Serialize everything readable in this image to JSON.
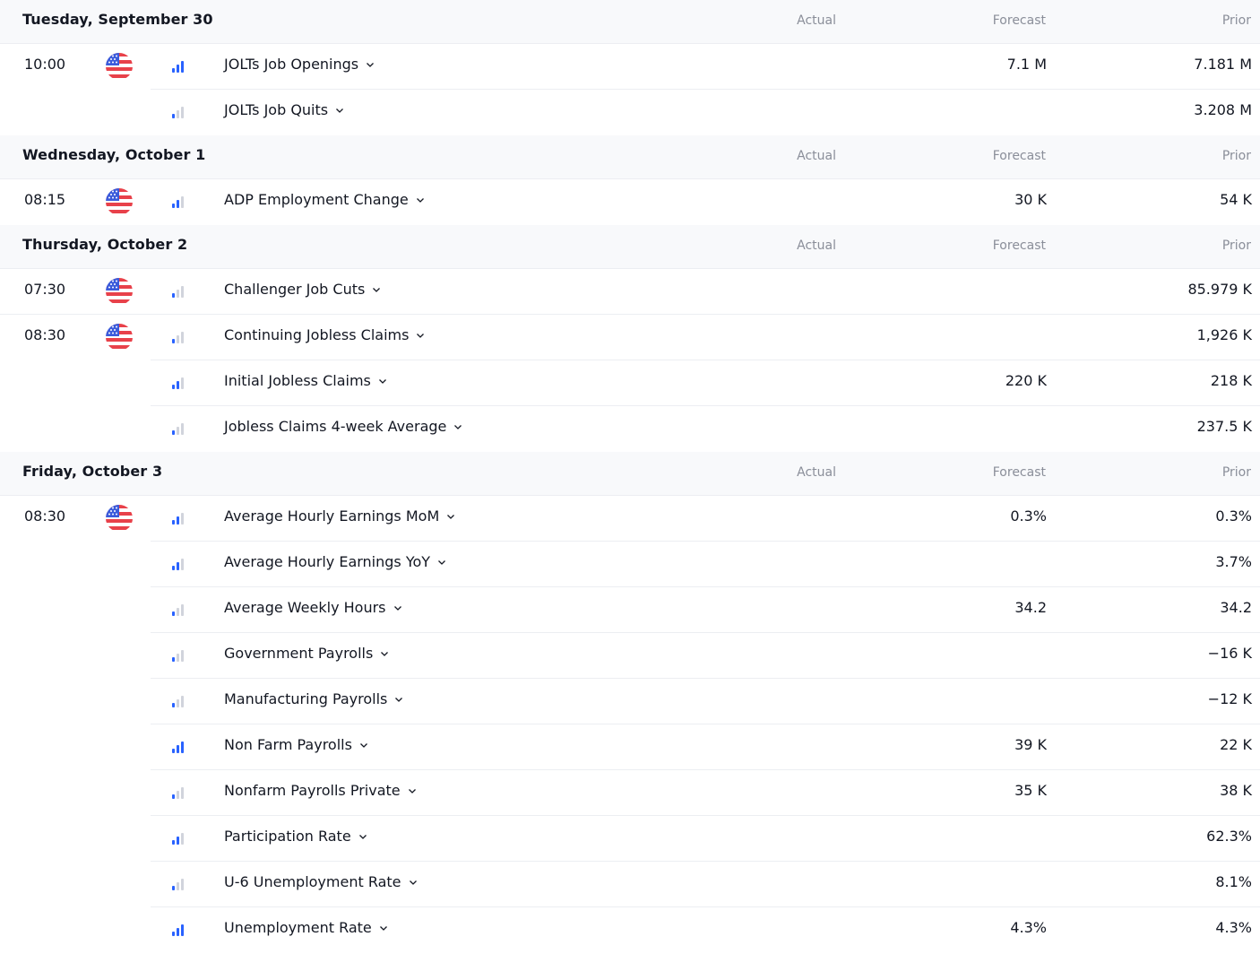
{
  "columns": {
    "actual": "Actual",
    "forecast": "Forecast",
    "prior": "Prior"
  },
  "colors": {
    "importance_on": "#2962ff",
    "importance_off": "#d1d4dc",
    "header_bg": "#f8f9fb"
  },
  "days": [
    {
      "title": "Tuesday, September 30",
      "events": [
        {
          "time": "10:00",
          "flag": true,
          "importance": 3,
          "name": "JOLTs Job Openings",
          "actual": "",
          "forecast": "7.1 M",
          "prior": "7.181 M"
        },
        {
          "time": "",
          "flag": false,
          "importance": 1,
          "name": "JOLTs Job Quits",
          "actual": "",
          "forecast": "",
          "prior": "3.208 M"
        }
      ]
    },
    {
      "title": "Wednesday, October 1",
      "events": [
        {
          "time": "08:15",
          "flag": true,
          "importance": 2,
          "name": "ADP Employment Change",
          "actual": "",
          "forecast": "30 K",
          "prior": "54 K"
        }
      ]
    },
    {
      "title": "Thursday, October 2",
      "events": [
        {
          "time": "07:30",
          "flag": true,
          "importance": 1,
          "name": "Challenger Job Cuts",
          "actual": "",
          "forecast": "",
          "prior": "85.979 K"
        },
        {
          "time": "08:30",
          "flag": true,
          "importance": 1,
          "name": "Continuing Jobless Claims",
          "actual": "",
          "forecast": "",
          "prior": "1,926 K"
        },
        {
          "time": "",
          "flag": false,
          "importance": 2,
          "name": "Initial Jobless Claims",
          "actual": "",
          "forecast": "220 K",
          "prior": "218 K"
        },
        {
          "time": "",
          "flag": false,
          "importance": 1,
          "name": "Jobless Claims 4-week Average",
          "actual": "",
          "forecast": "",
          "prior": "237.5 K"
        }
      ]
    },
    {
      "title": "Friday, October 3",
      "events": [
        {
          "time": "08:30",
          "flag": true,
          "importance": 2,
          "name": "Average Hourly Earnings MoM",
          "actual": "",
          "forecast": "0.3%",
          "prior": "0.3%"
        },
        {
          "time": "",
          "flag": false,
          "importance": 2,
          "name": "Average Hourly Earnings YoY",
          "actual": "",
          "forecast": "",
          "prior": "3.7%"
        },
        {
          "time": "",
          "flag": false,
          "importance": 1,
          "name": "Average Weekly Hours",
          "actual": "",
          "forecast": "34.2",
          "prior": "34.2"
        },
        {
          "time": "",
          "flag": false,
          "importance": 1,
          "name": "Government Payrolls",
          "actual": "",
          "forecast": "",
          "prior": "−16 K"
        },
        {
          "time": "",
          "flag": false,
          "importance": 1,
          "name": "Manufacturing Payrolls",
          "actual": "",
          "forecast": "",
          "prior": "−12 K"
        },
        {
          "time": "",
          "flag": false,
          "importance": 3,
          "name": "Non Farm Payrolls",
          "actual": "",
          "forecast": "39 K",
          "prior": "22 K"
        },
        {
          "time": "",
          "flag": false,
          "importance": 1,
          "name": "Nonfarm Payrolls Private",
          "actual": "",
          "forecast": "35 K",
          "prior": "38 K"
        },
        {
          "time": "",
          "flag": false,
          "importance": 2,
          "name": "Participation Rate",
          "actual": "",
          "forecast": "",
          "prior": "62.3%"
        },
        {
          "time": "",
          "flag": false,
          "importance": 1,
          "name": "U-6 Unemployment Rate",
          "actual": "",
          "forecast": "",
          "prior": "8.1%"
        },
        {
          "time": "",
          "flag": false,
          "importance": 3,
          "name": "Unemployment Rate",
          "actual": "",
          "forecast": "4.3%",
          "prior": "4.3%"
        }
      ]
    }
  ]
}
